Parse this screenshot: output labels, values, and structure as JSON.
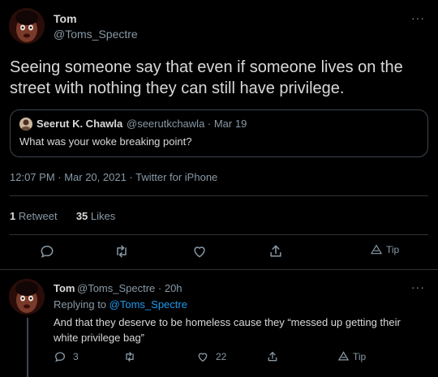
{
  "tweet": {
    "author_name": "Tom",
    "author_handle": "@Toms_Spectre",
    "more_label": "···",
    "text": "Seeing someone say that even if someone lives on the street with nothing they can still have privilege.",
    "quote": {
      "name": "Seerut K. Chawla",
      "meta": "@seerutkchawla · Mar 19",
      "text": "What was your woke breaking point?"
    },
    "timestamp": "12:07 PM · Mar 20, 2021 · Twitter for iPhone",
    "stats": {
      "retweet_count": "1",
      "retweet_label": "Retweet",
      "like_count": "35",
      "like_label": "Likes"
    },
    "tip_label": "Tip"
  },
  "reply": {
    "author_name": "Tom",
    "meta": "@Toms_Spectre · 20h",
    "replying_prefix": "Replying to ",
    "replying_to": "@Toms_Spectre",
    "text": "And that they deserve to be homeless cause they “messed up getting their white privilege bag”",
    "more_label": "···",
    "reply_count": "3",
    "like_count": "22",
    "tip_label": "Tip"
  },
  "colors": {
    "background": "#000000",
    "text": "#d9d9d9",
    "muted": "#8899a6",
    "link": "#1d9bf0",
    "border": "#2f3336"
  },
  "icons": [
    "reply-icon",
    "retweet-icon",
    "heart-icon",
    "share-icon",
    "tip-icon",
    "more-icon"
  ]
}
